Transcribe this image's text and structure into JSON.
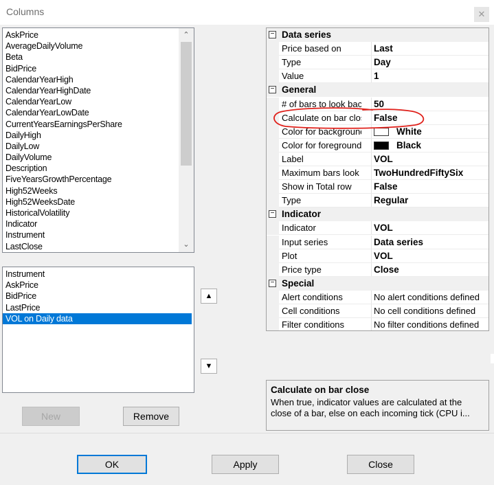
{
  "window": {
    "title": "Columns"
  },
  "available_columns": [
    "AskPrice",
    "AverageDailyVolume",
    "Beta",
    "BidPrice",
    "CalendarYearHigh",
    "CalendarYearHighDate",
    "CalendarYearLow",
    "CalendarYearLowDate",
    "CurrentYearsEarningsPerShare",
    "DailyHigh",
    "DailyLow",
    "DailyVolume",
    "Description",
    "FiveYearsGrowthPercentage",
    "High52Weeks",
    "High52WeeksDate",
    "HistoricalVolatility",
    "Indicator",
    "Instrument",
    "LastClose"
  ],
  "selected_columns": [
    "Instrument",
    "AskPrice",
    "BidPrice",
    "LastPrice",
    "VOL on Daily data"
  ],
  "selected_index": 4,
  "buttons": {
    "new": "New",
    "remove": "Remove",
    "ok": "OK",
    "apply": "Apply",
    "close": "Close"
  },
  "icons": {
    "move_up": "▲",
    "move_down": "▼",
    "scroll_up": "⌃",
    "scroll_down": "⌄",
    "collapse": "−",
    "close": "✕"
  },
  "properties": [
    {
      "category": "Data series",
      "rows": [
        {
          "name": "Price based on",
          "value": "Last"
        },
        {
          "name": "Type",
          "value": "Day"
        },
        {
          "name": "Value",
          "value": "1"
        }
      ]
    },
    {
      "category": "General",
      "rows": [
        {
          "name": "# of bars to look bacl",
          "value": "50"
        },
        {
          "name": "Calculate on bar clos",
          "value": "False"
        },
        {
          "name": "Color for backgrounc",
          "value": "White",
          "swatch": "#ffffff"
        },
        {
          "name": "Color for foreground",
          "value": "Black",
          "swatch": "#000000"
        },
        {
          "name": "Label",
          "value": "VOL"
        },
        {
          "name": "Maximum bars look l",
          "value": "TwoHundredFiftySix"
        },
        {
          "name": "Show in Total row",
          "value": "False"
        },
        {
          "name": "Type",
          "value": "Regular"
        }
      ]
    },
    {
      "category": "Indicator",
      "rows": [
        {
          "name": "Indicator",
          "value": "VOL"
        },
        {
          "name": "Input series",
          "value": "Data series"
        },
        {
          "name": "Plot",
          "value": "VOL"
        },
        {
          "name": "Price type",
          "value": "Close"
        }
      ]
    },
    {
      "category": "Special",
      "rows": [
        {
          "name": "Alert conditions",
          "value": "No alert conditions defined",
          "plain": true
        },
        {
          "name": "Cell conditions",
          "value": "No cell conditions defined",
          "plain": true
        },
        {
          "name": "Filter conditions",
          "value": "No filter conditions defined",
          "plain": true
        }
      ]
    }
  ],
  "description": {
    "title": "Calculate on bar close",
    "text": "When true, indicator values are calculated at the close of a bar, else on each incoming tick (CPU i..."
  },
  "colors": {
    "selection": "#0078d7",
    "annotation": "#e0201a"
  }
}
